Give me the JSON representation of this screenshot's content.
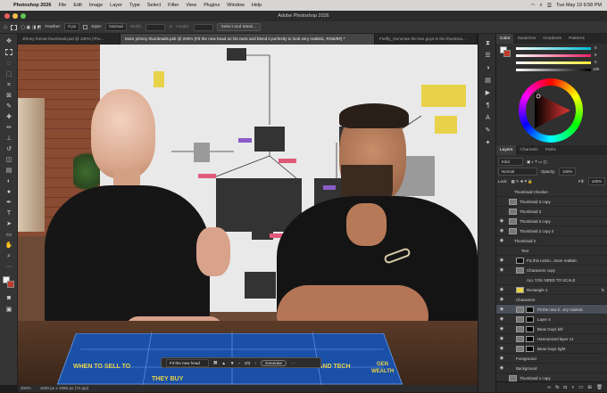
{
  "menubar": {
    "app_name": "Photoshop 2026",
    "items": [
      "File",
      "Edit",
      "Image",
      "Layer",
      "Type",
      "Select",
      "Filter",
      "View",
      "Plugins",
      "Window",
      "Help"
    ],
    "clock": "Tue May 19 9:58 PM"
  },
  "window": {
    "title": "Adobe Photoshop 2026"
  },
  "options": {
    "feather_label": "Feather:",
    "feather_value": "0 px",
    "style_label": "Style:",
    "style_value": "Normal",
    "width_label": "Width:",
    "height_label": "Height:",
    "select_mask": "Select and Mask..."
  },
  "tabs": [
    {
      "label": "Jthnny format thumbnail.psd @ 100% (Tho..."
    },
    {
      "label": "More johnny thumbnails.psb @ 200% (Fit the new head on his neck and blend it perfectly to look very realistic, RGB/8#) *"
    },
    {
      "label": "Firefly_Generate the two guys in the thumbna..."
    }
  ],
  "status": {
    "zoom": "200%",
    "doc": "1600 px x 1080 px (72 ppi)"
  },
  "color_panel": {
    "tabs": [
      "Color",
      "Swatches",
      "Gradients",
      "Patterns"
    ],
    "values": [
      "0",
      "0",
      "0",
      "100"
    ]
  },
  "layers_panel": {
    "tabs": [
      "Layers",
      "Channels",
      "Paths"
    ],
    "kind_label": "Kind",
    "blend_mode": "Normal",
    "opacity_label": "Opacity:",
    "opacity_value": "100%",
    "lock_label": "Lock:",
    "fill_label": "Fill:",
    "fill_value": "100%",
    "layers": [
      {
        "name": "Thumbnail Checker"
      },
      {
        "name": "Thumbnail 3 copy"
      },
      {
        "name": "Thumbnail 3"
      },
      {
        "name": "Thumbnail 2 copy"
      },
      {
        "name": "Thumbnail 2 copy 2"
      },
      {
        "name": "Thumbnail 2"
      },
      {
        "name": "Text"
      },
      {
        "name": "Fix this rockin...more realistic"
      },
      {
        "name": "Characters copy"
      },
      {
        "name": "ALL YOU NEED TO SCALE"
      },
      {
        "name": "Rectangle 1"
      },
      {
        "name": "Characters"
      },
      {
        "name": "Fit the new h...ery realistic"
      },
      {
        "name": "Layer 4"
      },
      {
        "name": "Beas Guys left"
      },
      {
        "name": "Harmonized layer 14"
      },
      {
        "name": "Beas Guys right"
      },
      {
        "name": "Foreground"
      },
      {
        "name": "Background"
      },
      {
        "name": "Thumbnail 1 copy"
      },
      {
        "name": "Thumbnail 1 copy 2"
      }
    ]
  },
  "context_bar": {
    "label": "Fit the new head",
    "page": "2/3",
    "generate": "Generate"
  },
  "board_text": {
    "line1": "WHEN TO SELL TO",
    "line2": "THEY BUY",
    "line3": "GEN",
    "line4": "WEALTH",
    "line5": "S AND TECH"
  },
  "colors": {
    "accent": "#4d8df7",
    "board_blue": "#1a50a8",
    "board_text": "#e8d24a",
    "menubar_bg": "#d7d5d2"
  }
}
